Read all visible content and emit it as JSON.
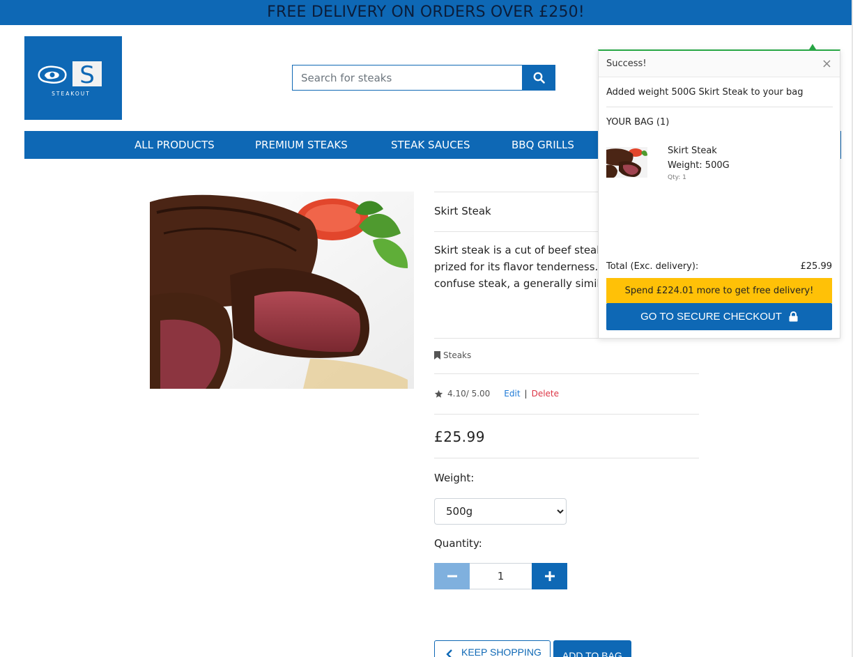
{
  "banner": {
    "text": "FREE DELIVERY ON ORDERS OVER £250!"
  },
  "logo": {
    "letter": "S",
    "wordmark": "STEAKOUT"
  },
  "search": {
    "placeholder": "Search for steaks",
    "value": ""
  },
  "nav": {
    "items": [
      {
        "label": "ALL PRODUCTS"
      },
      {
        "label": "PREMIUM STEAKS"
      },
      {
        "label": "STEAK SAUCES"
      },
      {
        "label": "BBQ GRILLS"
      }
    ]
  },
  "product": {
    "name": "Skirt Steak",
    "description": "Skirt steak is a cut of beef steak fr long, flat, and prized for its flavor tenderness. It is not to be confuse steak, a generally similar adjacen plate.",
    "category": "Steaks",
    "rating": "4.10/ 5.00",
    "edit_label": "Edit",
    "separator": "|",
    "delete_label": "Delete",
    "price": "£25.99",
    "weight_label": "Weight:",
    "weight_selected": "500g",
    "quantity_label": "Quantity:",
    "quantity_value": "1",
    "keep_shopping_label": "KEEP SHOPPING",
    "add_to_bag_label": "ADD TO BAG"
  },
  "toast": {
    "title": "Success!",
    "close": "×",
    "message": "Added weight 500G Skirt Steak to your bag",
    "bag_title": "YOUR BAG (1)",
    "item": {
      "name": "Skirt Steak",
      "weight": "Weight: 500G",
      "qty": "Qty: 1"
    },
    "total_label": "Total (Exc. delivery):",
    "total_value": "£25.99",
    "spend_message": "Spend £224.01 more to get free delivery!",
    "checkout_label": "GO TO SECURE CHECKOUT"
  },
  "colors": {
    "brand_blue": "#0e68b5",
    "success_green": "#28a745",
    "warning_yellow": "#ffc107",
    "delete_red": "#dc3545",
    "link_blue": "#1e7ad6"
  },
  "icons": {
    "search": "search-icon",
    "category": "bookmark-icon",
    "rating": "star-icon",
    "minus": "minus-icon",
    "plus": "plus-icon",
    "back": "chevron-left-icon",
    "lock": "lock-icon",
    "close": "close-icon"
  }
}
